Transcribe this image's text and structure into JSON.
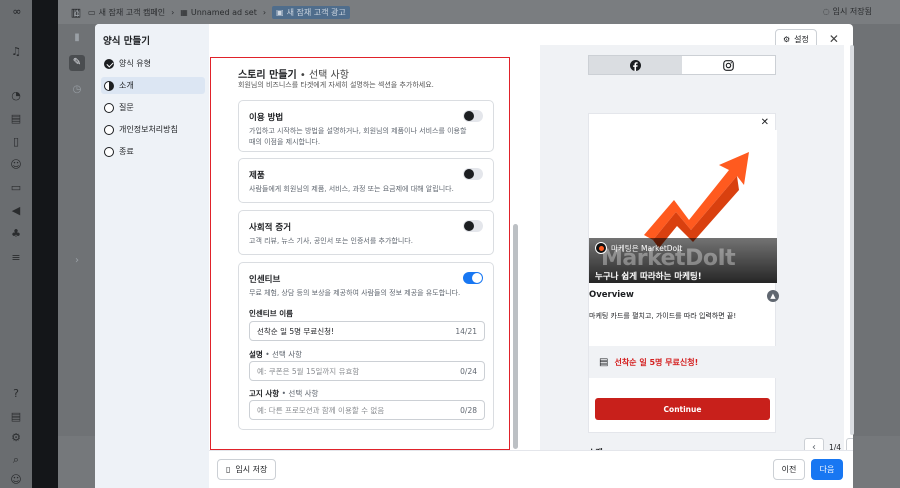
{
  "app": {
    "breadcrumbs": [
      {
        "label": "새 잠재 고객 캠페인",
        "icon": "folder-icon"
      },
      {
        "label": "Unnamed ad set",
        "icon": "grid-icon"
      },
      {
        "label": "새 잠재 고객 광고",
        "icon": "ad-icon"
      }
    ],
    "save_status": "임시 저장됨"
  },
  "sidebar": {
    "title": "양식 만들기",
    "steps": [
      {
        "label": "양식 유형",
        "state": "done"
      },
      {
        "label": "소개",
        "state": "active"
      },
      {
        "label": "질문",
        "state": "todo"
      },
      {
        "label": "개인정보처리방침",
        "state": "todo"
      },
      {
        "label": "종료",
        "state": "todo"
      }
    ]
  },
  "header": {
    "settings_label": "설정",
    "close_label": "✕"
  },
  "form": {
    "section_title": "스토리 만들기",
    "section_title_sep": " • ",
    "section_title_opt": "선택 사항",
    "section_desc": "회원님의 비즈니스를 타겟에게 자세히 설명하는 섹션을 추가하세요.",
    "cards": [
      {
        "title": "이용 방법",
        "desc": "가입하고 시작하는 방법을 설명하거나, 회원님의 제품이나 서비스를 이용할 때의 이점을 제시합니다.",
        "enabled": false
      },
      {
        "title": "제품",
        "desc": "사람들에게 회원님의 제품, 서비스, 과정 또는 요금제에 대해 알립니다.",
        "enabled": false
      },
      {
        "title": "사회적 증거",
        "desc": "고객 리뷰, 뉴스 기사, 공인서 또는 인증서를 추가합니다.",
        "enabled": false
      },
      {
        "title": "인센티브",
        "desc": "무료 체험, 상담 등의 보상을 제공하여 사람들의 정보 제공을 유도합니다.",
        "enabled": true
      }
    ],
    "incentive": {
      "name_label": "인센티브 이름",
      "name_value": "선착순 일 5명 무료신청!",
      "name_count": "14/21",
      "desc_label": "설명",
      "desc_opt": "선택 사항",
      "desc_placeholder": "예: 쿠폰은 5월 15일까지 유효함",
      "desc_count": "0/24",
      "notice_label": "고지 사항",
      "notice_opt": "선택 사항",
      "notice_placeholder": "예: 다른 프로모션과 함께 이용할 수 없음",
      "notice_count": "0/28"
    }
  },
  "preview": {
    "tabs": [
      "facebook-icon",
      "instagram-icon"
    ],
    "selected_tab": 0,
    "ad": {
      "brand": "마케팅은 MarketDoIt",
      "big_word": "MarketDoIt",
      "tagline": "누구나 쉽게 따라하는 마케팅!",
      "overview_title": "Overview",
      "overview_desc": "마케팅 카드를 펼치고, 가이드를 따라 입력하면 끝!",
      "cta_banner": "선착순 일 5명 무료신청!",
      "continue_label": "Continue"
    },
    "footer_label": "소개",
    "pager": "1/4"
  },
  "footer": {
    "draft_label": "임시 저장",
    "prev_label": "이전",
    "next_label": "다음"
  },
  "colors": {
    "accent": "#1877f2",
    "highlight_border": "#e0222a",
    "cta_red": "#c8201b"
  }
}
